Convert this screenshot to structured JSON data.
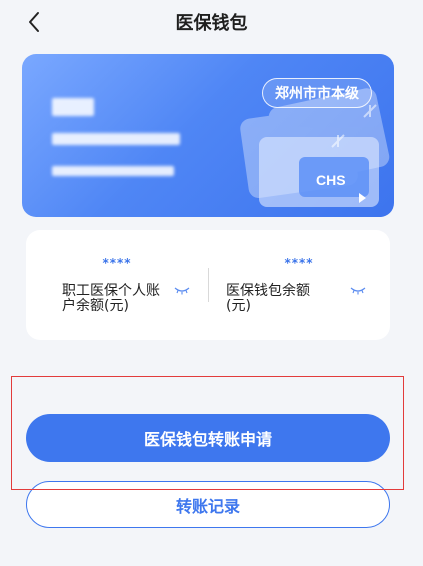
{
  "header": {
    "title": "医保钱包"
  },
  "card": {
    "region": "郑州市市本级",
    "logo_text": "CHS"
  },
  "balances": [
    {
      "masked_value": "****",
      "label": "职工医保个人账户余额(元)"
    },
    {
      "masked_value": "****",
      "label": "医保钱包余额(元)"
    }
  ],
  "actions": {
    "transfer_apply": "医保钱包转账申请",
    "transfer_records": "转账记录"
  },
  "colors": {
    "accent": "#3e77ee",
    "card_start": "#7aa8ff",
    "card_end": "#3d74ee",
    "highlight": "#e23b3b"
  }
}
